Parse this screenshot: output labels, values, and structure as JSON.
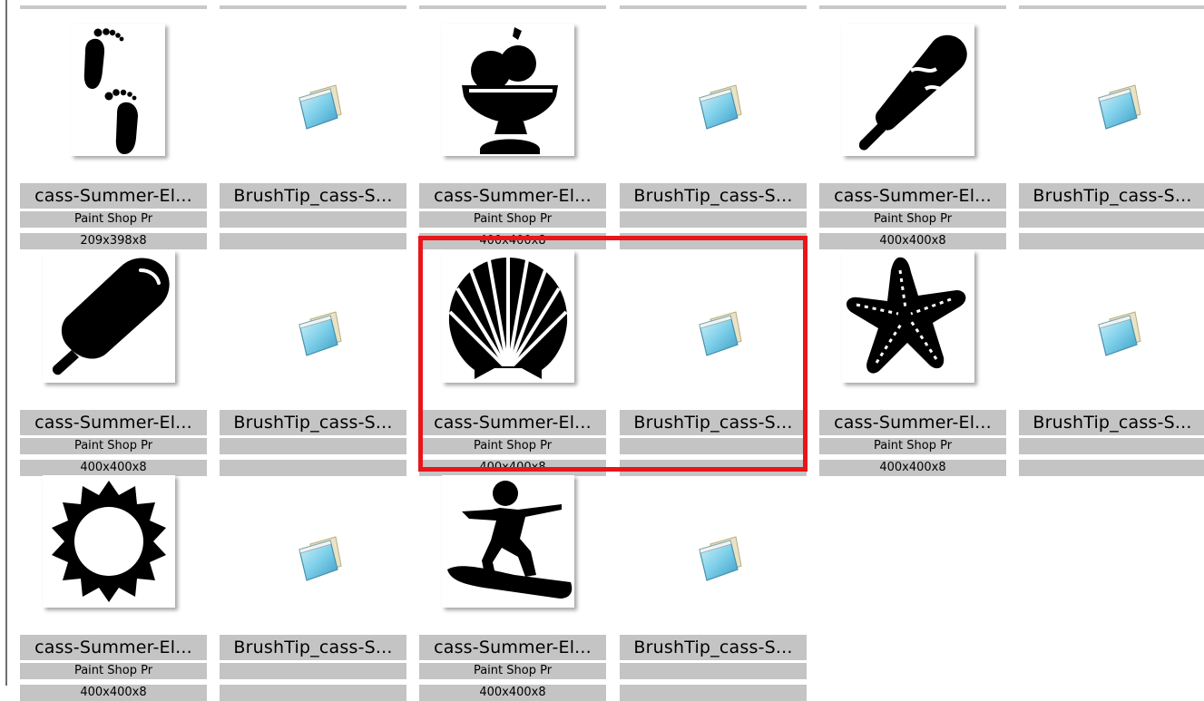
{
  "files": [
    {
      "name": "cass-Summer-El...",
      "type": "Paint Shop Pr",
      "dims": "209x398x8",
      "icon": "footprints-icon"
    },
    {
      "name": "BrushTip_cass-S...",
      "type": "",
      "dims": "",
      "icon": "notepad-file-icon"
    },
    {
      "name": "cass-Summer-El...",
      "type": "Paint Shop Pr",
      "dims": "400x400x8",
      "icon": "ice-cream-sundae-icon"
    },
    {
      "name": "BrushTip_cass-S...",
      "type": "",
      "dims": "",
      "icon": "notepad-file-icon"
    },
    {
      "name": "cass-Summer-El...",
      "type": "Paint Shop Pr",
      "dims": "400x400x8",
      "icon": "ice-cream-bar-icon"
    },
    {
      "name": "BrushTip_cass-S...",
      "type": "",
      "dims": "",
      "icon": "notepad-file-icon"
    },
    {
      "name": "cass-Summer-El...",
      "type": "Paint Shop Pr",
      "dims": "400x400x8",
      "icon": "popsicle-icon"
    },
    {
      "name": "BrushTip_cass-S...",
      "type": "",
      "dims": "",
      "icon": "notepad-file-icon"
    },
    {
      "name": "cass-Summer-El...",
      "type": "Paint Shop Pr",
      "dims": "400x400x8",
      "icon": "seashell-icon"
    },
    {
      "name": "BrushTip_cass-S...",
      "type": "",
      "dims": "",
      "icon": "notepad-file-icon"
    },
    {
      "name": "cass-Summer-El...",
      "type": "Paint Shop Pr",
      "dims": "400x400x8",
      "icon": "starfish-icon"
    },
    {
      "name": "BrushTip_cass-S...",
      "type": "",
      "dims": "",
      "icon": "notepad-file-icon"
    },
    {
      "name": "cass-Summer-El...",
      "type": "Paint Shop Pr",
      "dims": "400x400x8",
      "icon": "sun-icon"
    },
    {
      "name": "BrushTip_cass-S...",
      "type": "",
      "dims": "",
      "icon": "notepad-file-icon"
    },
    {
      "name": "cass-Summer-El...",
      "type": "Paint Shop Pr",
      "dims": "400x400x8",
      "icon": "surfer-icon"
    },
    {
      "name": "BrushTip_cass-S...",
      "type": "",
      "dims": "",
      "icon": "notepad-file-icon"
    }
  ],
  "colors": {
    "label_bg": "#c4c4c4",
    "selection": "#e8161a"
  }
}
